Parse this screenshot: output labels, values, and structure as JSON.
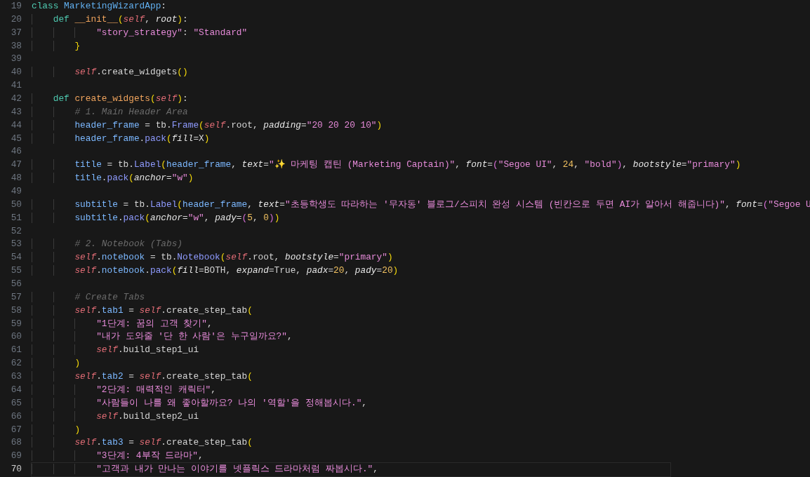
{
  "editor": {
    "lines": [
      {
        "number": "19",
        "tokens": [
          {
            "kind": "kw",
            "text": "class "
          },
          {
            "kind": "cls",
            "text": "MarketingWizardApp"
          },
          {
            "kind": "plain",
            "text": ":"
          }
        ]
      },
      {
        "number": "20",
        "tokens": [
          {
            "kind": "kw",
            "text": "    def "
          },
          {
            "kind": "fn",
            "text": "__init__"
          },
          {
            "kind": "br",
            "text": "("
          },
          {
            "kind": "self",
            "text": "self"
          },
          {
            "kind": "plain",
            "text": ", "
          },
          {
            "kind": "param",
            "text": "root"
          },
          {
            "kind": "br",
            "text": ")"
          },
          {
            "kind": "plain",
            "text": ":"
          }
        ]
      },
      {
        "number": "37",
        "tokens": [
          {
            "kind": "str",
            "text": "            \"story_strategy\""
          },
          {
            "kind": "plain",
            "text": ": "
          },
          {
            "kind": "str",
            "text": "\"Standard\""
          }
        ]
      },
      {
        "number": "38",
        "tokens": [
          {
            "kind": "br",
            "text": "        }"
          }
        ]
      },
      {
        "number": "39"
      },
      {
        "number": "40",
        "tokens": [
          {
            "kind": "self",
            "text": "        self"
          },
          {
            "kind": "plain",
            "text": ".create_widgets"
          },
          {
            "kind": "br",
            "text": "()"
          }
        ]
      },
      {
        "number": "41"
      },
      {
        "number": "42",
        "tokens": [
          {
            "kind": "kw",
            "text": "    def "
          },
          {
            "kind": "fn",
            "text": "create_widgets"
          },
          {
            "kind": "br",
            "text": "("
          },
          {
            "kind": "self",
            "text": "self"
          },
          {
            "kind": "br",
            "text": ")"
          },
          {
            "kind": "plain",
            "text": ":"
          }
        ]
      },
      {
        "number": "43",
        "tokens": [
          {
            "kind": "cmt",
            "text": "        # 1. Main Header Area"
          }
        ]
      },
      {
        "number": "44",
        "tokens": [
          {
            "kind": "var",
            "text": "        header_frame"
          },
          {
            "kind": "plain",
            "text": " = tb."
          },
          {
            "kind": "method",
            "text": "Frame"
          },
          {
            "kind": "br",
            "text": "("
          },
          {
            "kind": "self",
            "text": "self"
          },
          {
            "kind": "plain",
            "text": ".root, "
          },
          {
            "kind": "param",
            "text": "padding"
          },
          {
            "kind": "plain",
            "text": "="
          },
          {
            "kind": "str",
            "text": "\"20 20 20 10\""
          },
          {
            "kind": "br",
            "text": ")"
          }
        ]
      },
      {
        "number": "45",
        "tokens": [
          {
            "kind": "var",
            "text": "        header_frame"
          },
          {
            "kind": "plain",
            "text": "."
          },
          {
            "kind": "method",
            "text": "pack"
          },
          {
            "kind": "br",
            "text": "("
          },
          {
            "kind": "param",
            "text": "fill"
          },
          {
            "kind": "plain",
            "text": "=X"
          },
          {
            "kind": "br",
            "text": ")"
          }
        ]
      },
      {
        "number": "46"
      },
      {
        "number": "47",
        "tokens": [
          {
            "kind": "var",
            "text": "        title"
          },
          {
            "kind": "plain",
            "text": " = tb."
          },
          {
            "kind": "method",
            "text": "Label"
          },
          {
            "kind": "br",
            "text": "("
          },
          {
            "kind": "var",
            "text": "header_frame"
          },
          {
            "kind": "plain",
            "text": ", "
          },
          {
            "kind": "param",
            "text": "text"
          },
          {
            "kind": "plain",
            "text": "="
          },
          {
            "kind": "str",
            "text": "\"✨ 마케팅 캡틴 (Marketing Captain)\""
          },
          {
            "kind": "plain",
            "text": ", "
          },
          {
            "kind": "param",
            "text": "font"
          },
          {
            "kind": "plain",
            "text": "="
          },
          {
            "kind": "br2",
            "text": "("
          },
          {
            "kind": "str",
            "text": "\"Segoe UI\""
          },
          {
            "kind": "plain",
            "text": ", "
          },
          {
            "kind": "num",
            "text": "24"
          },
          {
            "kind": "plain",
            "text": ", "
          },
          {
            "kind": "str",
            "text": "\"bold\""
          },
          {
            "kind": "br2",
            "text": ")"
          },
          {
            "kind": "plain",
            "text": ", "
          },
          {
            "kind": "param",
            "text": "bootstyle"
          },
          {
            "kind": "plain",
            "text": "="
          },
          {
            "kind": "str",
            "text": "\"primary\""
          },
          {
            "kind": "br",
            "text": ")"
          }
        ]
      },
      {
        "number": "48",
        "tokens": [
          {
            "kind": "var",
            "text": "        title"
          },
          {
            "kind": "plain",
            "text": "."
          },
          {
            "kind": "method",
            "text": "pack"
          },
          {
            "kind": "br",
            "text": "("
          },
          {
            "kind": "param",
            "text": "anchor"
          },
          {
            "kind": "plain",
            "text": "="
          },
          {
            "kind": "str",
            "text": "\"w\""
          },
          {
            "kind": "br",
            "text": ")"
          }
        ]
      },
      {
        "number": "49"
      },
      {
        "number": "50",
        "tokens": [
          {
            "kind": "var",
            "text": "        subtitle"
          },
          {
            "kind": "plain",
            "text": " = tb."
          },
          {
            "kind": "method",
            "text": "Label"
          },
          {
            "kind": "br",
            "text": "("
          },
          {
            "kind": "var",
            "text": "header_frame"
          },
          {
            "kind": "plain",
            "text": ", "
          },
          {
            "kind": "param",
            "text": "text"
          },
          {
            "kind": "plain",
            "text": "="
          },
          {
            "kind": "str",
            "text": "\"초등학생도 따라하는 '무자동' 블로그/스피치 완성 시스템 (빈칸으로 두면 AI가 알아서 해줍니다)\""
          },
          {
            "kind": "plain",
            "text": ", "
          },
          {
            "kind": "param",
            "text": "font"
          },
          {
            "kind": "plain",
            "text": "="
          },
          {
            "kind": "br2",
            "text": "("
          },
          {
            "kind": "str",
            "text": "\"Segoe U"
          }
        ]
      },
      {
        "number": "51",
        "tokens": [
          {
            "kind": "var",
            "text": "        subtitle"
          },
          {
            "kind": "plain",
            "text": "."
          },
          {
            "kind": "method",
            "text": "pack"
          },
          {
            "kind": "br",
            "text": "("
          },
          {
            "kind": "param",
            "text": "anchor"
          },
          {
            "kind": "plain",
            "text": "="
          },
          {
            "kind": "str",
            "text": "\"w\""
          },
          {
            "kind": "plain",
            "text": ", "
          },
          {
            "kind": "param",
            "text": "pady"
          },
          {
            "kind": "plain",
            "text": "="
          },
          {
            "kind": "br2",
            "text": "("
          },
          {
            "kind": "num",
            "text": "5"
          },
          {
            "kind": "plain",
            "text": ", "
          },
          {
            "kind": "num",
            "text": "0"
          },
          {
            "kind": "br2",
            "text": ")"
          },
          {
            "kind": "br",
            "text": ")"
          }
        ]
      },
      {
        "number": "52"
      },
      {
        "number": "53",
        "tokens": [
          {
            "kind": "cmt",
            "text": "        # 2. Notebook (Tabs)"
          }
        ]
      },
      {
        "number": "54",
        "tokens": [
          {
            "kind": "self",
            "text": "        self"
          },
          {
            "kind": "plain",
            "text": "."
          },
          {
            "kind": "var",
            "text": "notebook"
          },
          {
            "kind": "plain",
            "text": " = tb."
          },
          {
            "kind": "method",
            "text": "Notebook"
          },
          {
            "kind": "br",
            "text": "("
          },
          {
            "kind": "self",
            "text": "self"
          },
          {
            "kind": "plain",
            "text": ".root, "
          },
          {
            "kind": "param",
            "text": "bootstyle"
          },
          {
            "kind": "plain",
            "text": "="
          },
          {
            "kind": "str",
            "text": "\"primary\""
          },
          {
            "kind": "br",
            "text": ")"
          }
        ]
      },
      {
        "number": "55",
        "tokens": [
          {
            "kind": "self",
            "text": "        self"
          },
          {
            "kind": "plain",
            "text": "."
          },
          {
            "kind": "var",
            "text": "notebook"
          },
          {
            "kind": "plain",
            "text": "."
          },
          {
            "kind": "method",
            "text": "pack"
          },
          {
            "kind": "br",
            "text": "("
          },
          {
            "kind": "param",
            "text": "fill"
          },
          {
            "kind": "plain",
            "text": "=BOTH, "
          },
          {
            "kind": "param",
            "text": "expand"
          },
          {
            "kind": "plain",
            "text": "=True, "
          },
          {
            "kind": "param",
            "text": "padx"
          },
          {
            "kind": "plain",
            "text": "="
          },
          {
            "kind": "num",
            "text": "20"
          },
          {
            "kind": "plain",
            "text": ", "
          },
          {
            "kind": "param",
            "text": "pady"
          },
          {
            "kind": "plain",
            "text": "="
          },
          {
            "kind": "num",
            "text": "20"
          },
          {
            "kind": "br",
            "text": ")"
          }
        ]
      },
      {
        "number": "56"
      },
      {
        "number": "57",
        "tokens": [
          {
            "kind": "cmt",
            "text": "        # Create Tabs"
          }
        ]
      },
      {
        "number": "58",
        "tokens": [
          {
            "kind": "self",
            "text": "        self"
          },
          {
            "kind": "plain",
            "text": "."
          },
          {
            "kind": "var",
            "text": "tab1"
          },
          {
            "kind": "plain",
            "text": " = "
          },
          {
            "kind": "self",
            "text": "self"
          },
          {
            "kind": "plain",
            "text": ".create_step_tab"
          },
          {
            "kind": "br",
            "text": "("
          }
        ]
      },
      {
        "number": "59",
        "tokens": [
          {
            "kind": "str",
            "text": "            \"1단계: 꿈의 고객 찾기\""
          },
          {
            "kind": "plain",
            "text": ","
          }
        ]
      },
      {
        "number": "60",
        "tokens": [
          {
            "kind": "str",
            "text": "            \"내가 도와줄 '단 한 사람'은 누구일까요?\""
          },
          {
            "kind": "plain",
            "text": ","
          }
        ]
      },
      {
        "number": "61",
        "tokens": [
          {
            "kind": "self",
            "text": "            self"
          },
          {
            "kind": "plain",
            "text": ".build_step1_ui"
          }
        ]
      },
      {
        "number": "62",
        "tokens": [
          {
            "kind": "br",
            "text": "        )"
          }
        ]
      },
      {
        "number": "63",
        "tokens": [
          {
            "kind": "self",
            "text": "        self"
          },
          {
            "kind": "plain",
            "text": "."
          },
          {
            "kind": "var",
            "text": "tab2"
          },
          {
            "kind": "plain",
            "text": " = "
          },
          {
            "kind": "self",
            "text": "self"
          },
          {
            "kind": "plain",
            "text": ".create_step_tab"
          },
          {
            "kind": "br",
            "text": "("
          }
        ]
      },
      {
        "number": "64",
        "tokens": [
          {
            "kind": "str",
            "text": "            \"2단계: 매력적인 캐릭터\""
          },
          {
            "kind": "plain",
            "text": ","
          }
        ]
      },
      {
        "number": "65",
        "tokens": [
          {
            "kind": "str",
            "text": "            \"사람들이 나를 왜 좋아할까요? 나의 '역할'을 정해봅시다.\""
          },
          {
            "kind": "plain",
            "text": ","
          }
        ]
      },
      {
        "number": "66",
        "tokens": [
          {
            "kind": "self",
            "text": "            self"
          },
          {
            "kind": "plain",
            "text": ".build_step2_ui"
          }
        ]
      },
      {
        "number": "67",
        "tokens": [
          {
            "kind": "br",
            "text": "        )"
          }
        ]
      },
      {
        "number": "68",
        "tokens": [
          {
            "kind": "self",
            "text": "        self"
          },
          {
            "kind": "plain",
            "text": "."
          },
          {
            "kind": "var",
            "text": "tab3"
          },
          {
            "kind": "plain",
            "text": " = "
          },
          {
            "kind": "self",
            "text": "self"
          },
          {
            "kind": "plain",
            "text": ".create_step_tab"
          },
          {
            "kind": "br",
            "text": "("
          }
        ]
      },
      {
        "number": "69",
        "tokens": [
          {
            "kind": "str",
            "text": "            \"3단계: 4부작 드라마\""
          },
          {
            "kind": "plain",
            "text": ","
          }
        ]
      },
      {
        "number": "70",
        "current": true,
        "tokens": [
          {
            "kind": "str",
            "text": "            \"고객과 내가 만나는 이야기를 넷플릭스 드라마처럼 짜봅시다.\""
          },
          {
            "kind": "plain",
            "text": ","
          }
        ]
      }
    ]
  }
}
